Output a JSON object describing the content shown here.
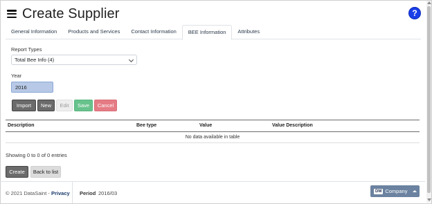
{
  "header": {
    "title": "Create Supplier",
    "help_label": "?"
  },
  "tabs": [
    {
      "label": "General Information",
      "active": false
    },
    {
      "label": "Products and Services",
      "active": false
    },
    {
      "label": "Contact Information",
      "active": false
    },
    {
      "label": "BEE Information",
      "active": true
    },
    {
      "label": "Attributes",
      "active": false
    }
  ],
  "form": {
    "report_types_label": "Report Types",
    "report_types_value": "Total Bee Info (4)",
    "year_label": "Year",
    "year_value": "2016"
  },
  "actions": {
    "import": "Import",
    "new": "New",
    "edit": "Edit",
    "save": "Save",
    "cancel": "Cancel"
  },
  "table": {
    "columns": [
      "Description",
      "Bee type",
      "Value",
      "Value Description"
    ],
    "empty_message": "No data available in table"
  },
  "entries_info": "Showing 0 to 0 of 0 entries",
  "bottom_actions": {
    "create": "Create",
    "back": "Back to list"
  },
  "footer": {
    "copyright": "© 2021 DataSaint - ",
    "privacy": "Privacy",
    "period_label": "Period",
    "period_value": "2016/03",
    "company_badge": "DM",
    "company_label": "Company"
  },
  "colors": {
    "accent": "#1a3ee8",
    "save": "#67c28c",
    "cancel": "#e57b84",
    "dark_button": "#6b6b6b",
    "company_button": "#6b82a0"
  }
}
